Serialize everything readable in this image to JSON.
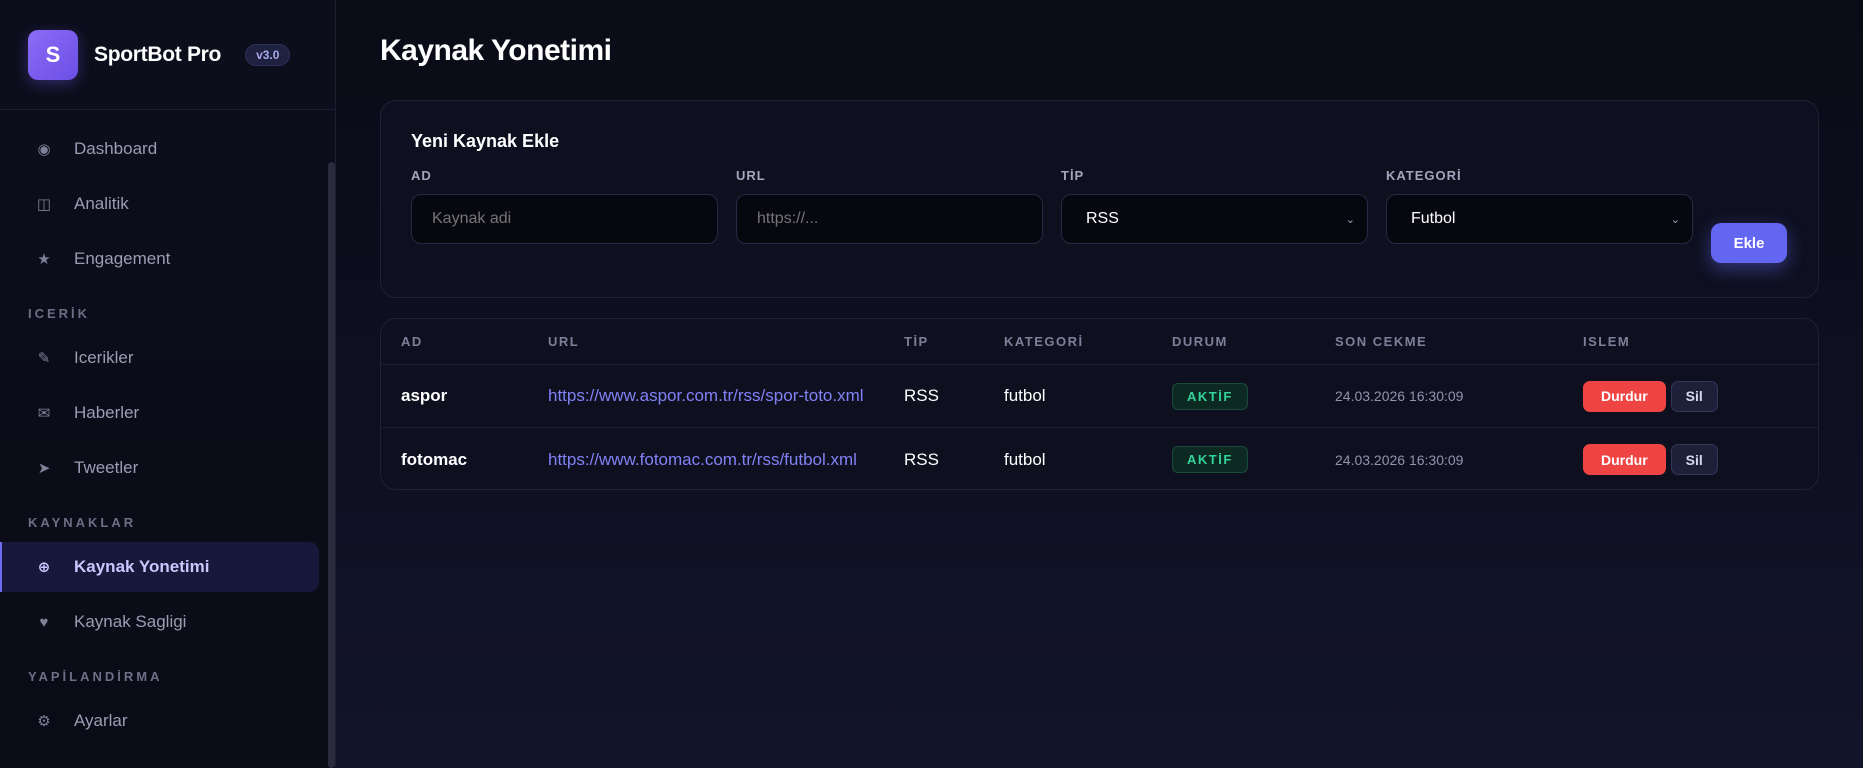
{
  "brand": {
    "logo_letter": "S",
    "name": "SportBot Pro",
    "version": "v3.0"
  },
  "sidebar": {
    "items_top": [
      {
        "label": "Dashboard",
        "icon": "dashboard-icon",
        "glyph": "◉"
      },
      {
        "label": "Analitik",
        "icon": "analytics-icon",
        "glyph": "◫"
      },
      {
        "label": "Engagement",
        "icon": "star-icon",
        "glyph": "★"
      }
    ],
    "section_content": "ICERİK",
    "items_content": [
      {
        "label": "Icerikler",
        "icon": "pencil-icon",
        "glyph": "✎"
      },
      {
        "label": "Haberler",
        "icon": "mail-icon",
        "glyph": "✉"
      },
      {
        "label": "Tweetler",
        "icon": "send-icon",
        "glyph": "➤"
      }
    ],
    "section_sources": "KAYNAKLAR",
    "items_sources": [
      {
        "label": "Kaynak Yonetimi",
        "icon": "globe-icon",
        "glyph": "⊕",
        "active": true
      },
      {
        "label": "Kaynak Sagligi",
        "icon": "heart-icon",
        "glyph": "♥"
      }
    ],
    "section_config": "YAPİLANDİRMA",
    "items_config": [
      {
        "label": "Ayarlar",
        "icon": "gear-icon",
        "glyph": "⚙"
      }
    ]
  },
  "page": {
    "title": "Kaynak Yonetimi"
  },
  "add_form": {
    "title": "Yeni Kaynak Ekle",
    "name_label": "AD",
    "name_placeholder": "Kaynak adi",
    "url_label": "URL",
    "url_placeholder": "https://...",
    "type_label": "TİP",
    "type_value": "RSS",
    "category_label": "KATEGORİ",
    "category_value": "Futbol",
    "submit_label": "Ekle"
  },
  "table": {
    "headers": [
      "AD",
      "URL",
      "TİP",
      "KATEGORİ",
      "DURUM",
      "SON CEKME",
      "ISLEM"
    ],
    "rows": [
      {
        "name": "aspor",
        "url": "https://www.aspor.com.tr/rss/spor-toto.xml",
        "type": "RSS",
        "category": "futbol",
        "status": "AKTİF",
        "last_fetch": "24.03.2026 16:30:09",
        "stop_label": "Durdur",
        "delete_label": "Sil"
      },
      {
        "name": "fotomac",
        "url": "https://www.fotomac.com.tr/rss/futbol.xml",
        "type": "RSS",
        "category": "futbol",
        "status": "AKTİF",
        "last_fetch": "24.03.2026 16:30:09",
        "stop_label": "Durdur",
        "delete_label": "Sil"
      }
    ]
  },
  "colors": {
    "accent": "#6366f1",
    "danger": "#ef4444",
    "success": "#34d399",
    "background": "#0b0d1a"
  }
}
